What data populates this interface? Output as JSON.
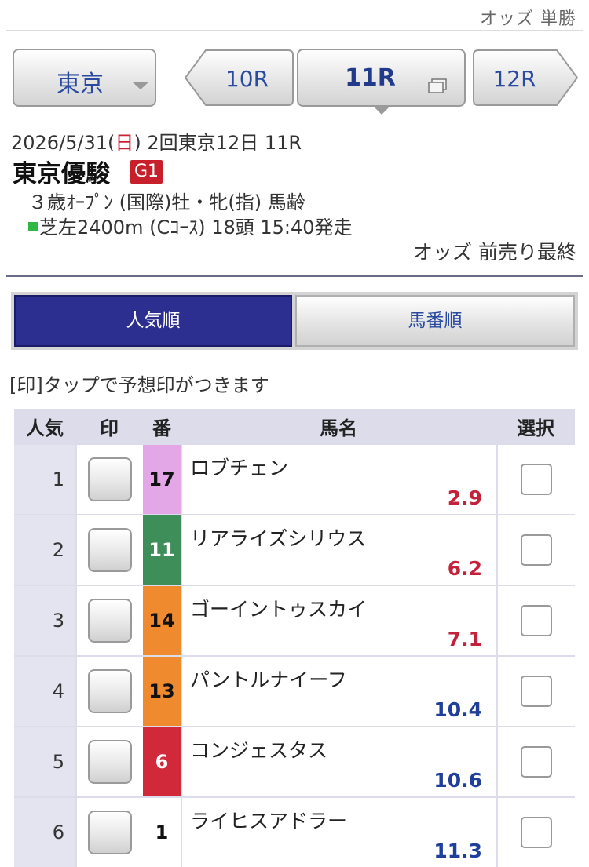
{
  "header": {
    "title": "オッズ 単勝"
  },
  "race_nav": {
    "venue": "東京",
    "prev_race": "10R",
    "current_race": "11R",
    "next_race": "12R"
  },
  "race_info": {
    "date_prefix": "2026/5/31(",
    "day_of_week": "日",
    "date_suffix": ") 2回東京12日 11R",
    "race_name": "東京優駿",
    "grade": "G1",
    "conditions": "３歳ｵｰﾌﾟﾝ (国際)牡・牝(指) 馬齢",
    "course": "芝左2400m (Cｺｰｽ) 18頭 15:40発走",
    "odds_type": "オッズ 前売り最終"
  },
  "sort_tabs": {
    "popular": "人気順",
    "number": "馬番順"
  },
  "hint": "[印]タップで予想印がつきます",
  "table": {
    "headers": {
      "rank": "人気",
      "mark": "印",
      "num": "番",
      "name": "馬名",
      "select": "選択"
    },
    "rows": [
      {
        "rank": "1",
        "num": "17",
        "name": "ロブチェン",
        "odds": "2.9",
        "odds_color": "red",
        "frame": "pink"
      },
      {
        "rank": "2",
        "num": "11",
        "name": "リアライズシリウス",
        "odds": "6.2",
        "odds_color": "red",
        "frame": "green"
      },
      {
        "rank": "3",
        "num": "14",
        "name": "ゴーイントゥスカイ",
        "odds": "7.1",
        "odds_color": "red",
        "frame": "orange"
      },
      {
        "rank": "4",
        "num": "13",
        "name": "パントルナイーフ",
        "odds": "10.4",
        "odds_color": "blue",
        "frame": "orange"
      },
      {
        "rank": "5",
        "num": "6",
        "name": "コンジェスタス",
        "odds": "10.6",
        "odds_color": "blue",
        "frame": "red"
      },
      {
        "rank": "6",
        "num": "1",
        "name": "ライヒスアドラー",
        "odds": "11.3",
        "odds_color": "blue",
        "frame": "white"
      }
    ]
  },
  "colors": {
    "frame_pink": "#e3a7e8",
    "frame_green": "#3e8e5a",
    "frame_orange": "#ef8a2e",
    "frame_red": "#d1283a",
    "frame_white": "#ffffff",
    "odds_red": "#c4223a",
    "odds_blue": "#1f3f9a",
    "active_tab": "#2d2f90"
  }
}
